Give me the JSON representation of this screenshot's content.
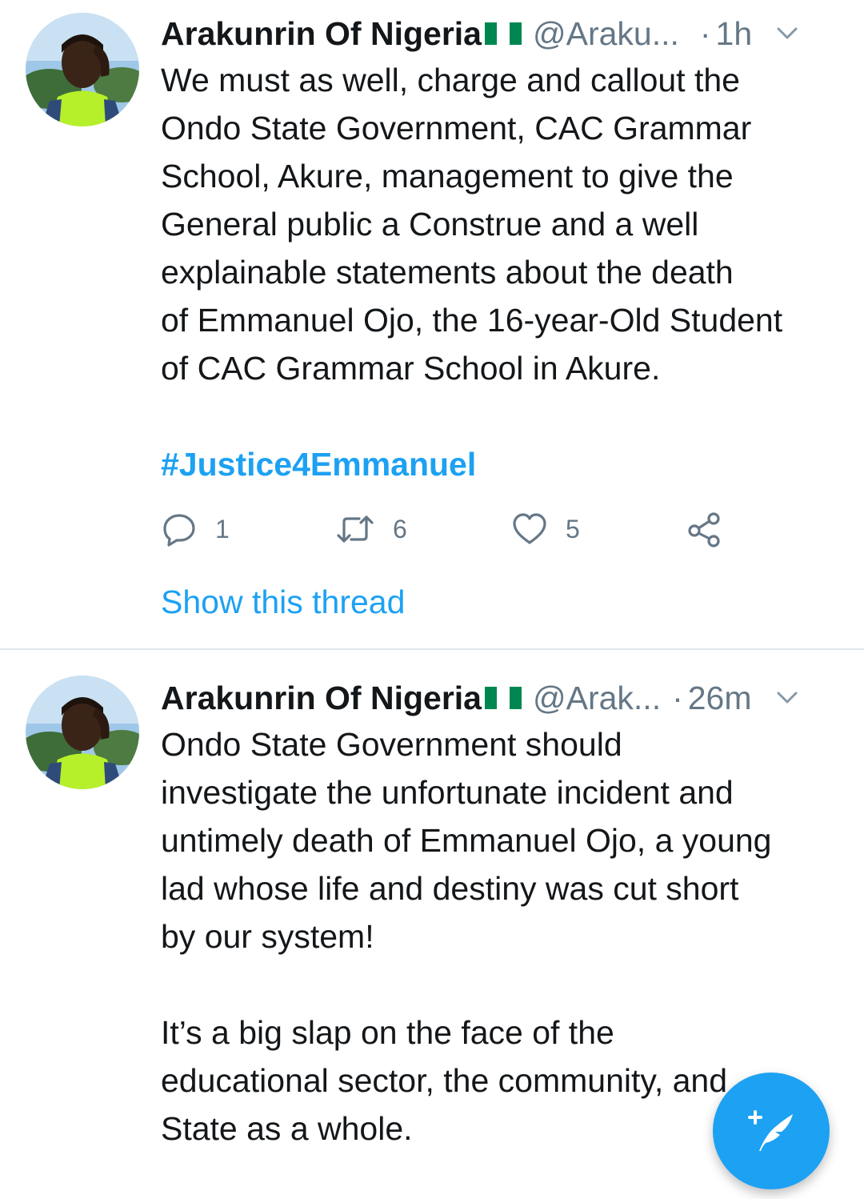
{
  "tweets": [
    {
      "name": "Arakunrin Of Nigeria",
      "handle": "@Araku...",
      "dot": "·",
      "time": "1h",
      "text": "We must as well, charge and callout the\nOndo State Government, CAC Grammar\nSchool, Akure, management to give the\nGeneral public a Construe and a well\nexplainable statements about the death\nof Emmanuel Ojo, the 16-year-Old Student\nof CAC Grammar School in Akure.",
      "hashtag": "#Justice4Emmanuel",
      "replies": "1",
      "retweets": "6",
      "likes": "5",
      "thread_link": "Show this thread"
    },
    {
      "name": "Arakunrin Of Nigeria",
      "handle": "@Arak...",
      "dot": "·",
      "time": "26m",
      "text": "Ondo State Government should\ninvestigate the unfortunate incident and\nuntimely death of Emmanuel Ojo, a young\nlad whose life and destiny was cut short\nby our system!\n\nIt’s a big slap on the face of the\neducational sector, the community, and\nState as a whole."
    }
  ],
  "icons": {
    "reply": "reply-icon",
    "retweet": "retweet-icon",
    "like": "heart-icon",
    "share": "share-icon",
    "menu": "chevron-down-icon",
    "compose": "compose-tweet-icon",
    "flag": "nigeria-flag-icon"
  },
  "colors": {
    "accent": "#1da1f2",
    "secondary_text": "#657786",
    "primary_text": "#14171a",
    "divider": "#e1e8ed",
    "flag_green": "#008751"
  }
}
